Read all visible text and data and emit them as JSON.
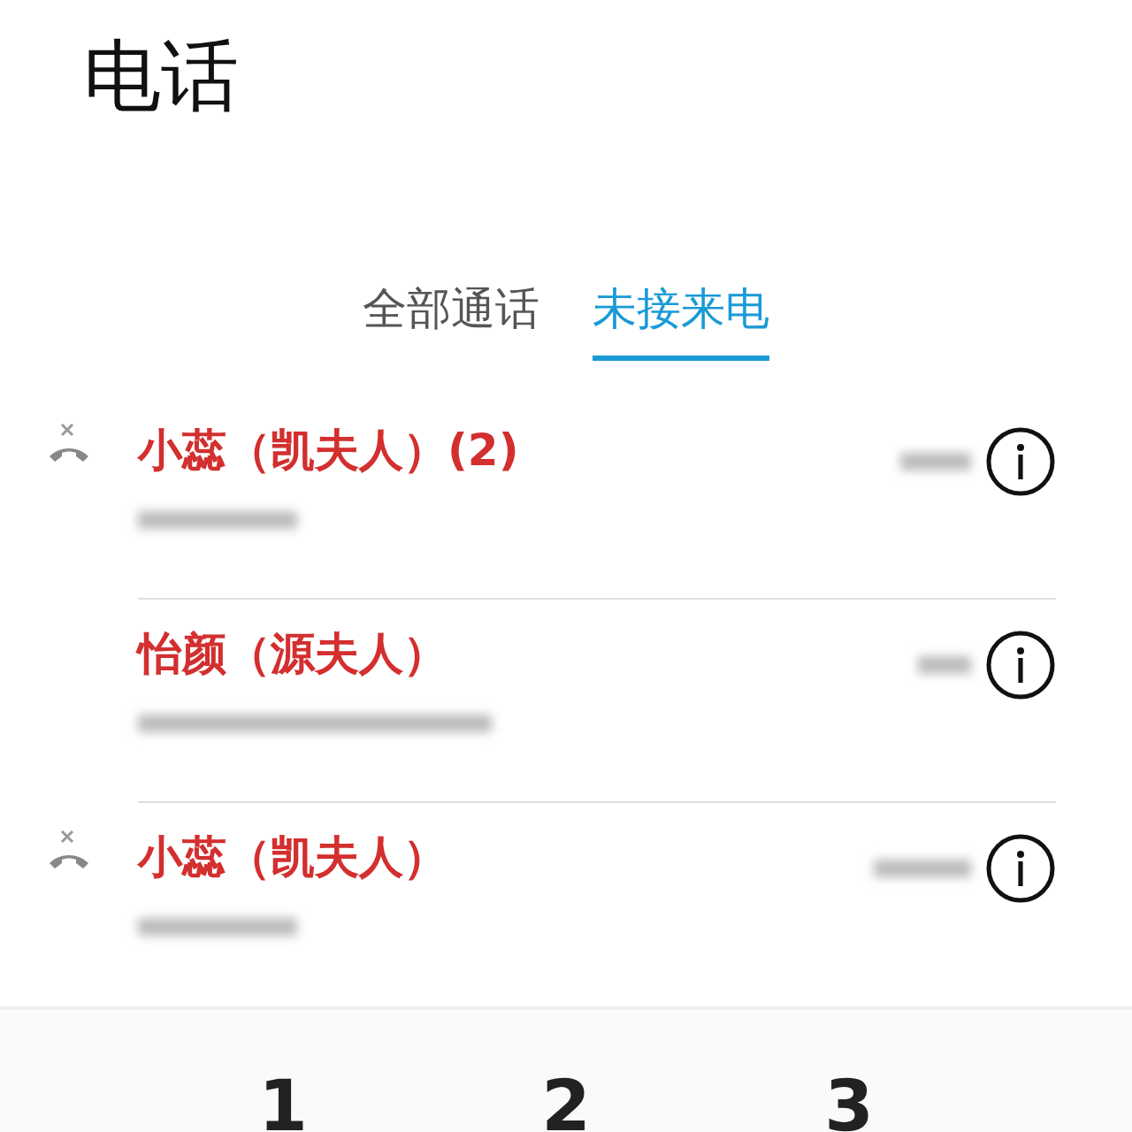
{
  "title": "电话",
  "tabs": [
    {
      "label": "全部通话",
      "selected": false
    },
    {
      "label": "未接来电",
      "selected": true
    }
  ],
  "calls": [
    {
      "name": "小蕊（凯夫人）(2)",
      "missed": true
    },
    {
      "name": "怡颜（源夫人）",
      "missed": false
    },
    {
      "name": "小蕊（凯夫人）",
      "missed": true
    }
  ],
  "dialpad": [
    "1",
    "2",
    "3"
  ]
}
